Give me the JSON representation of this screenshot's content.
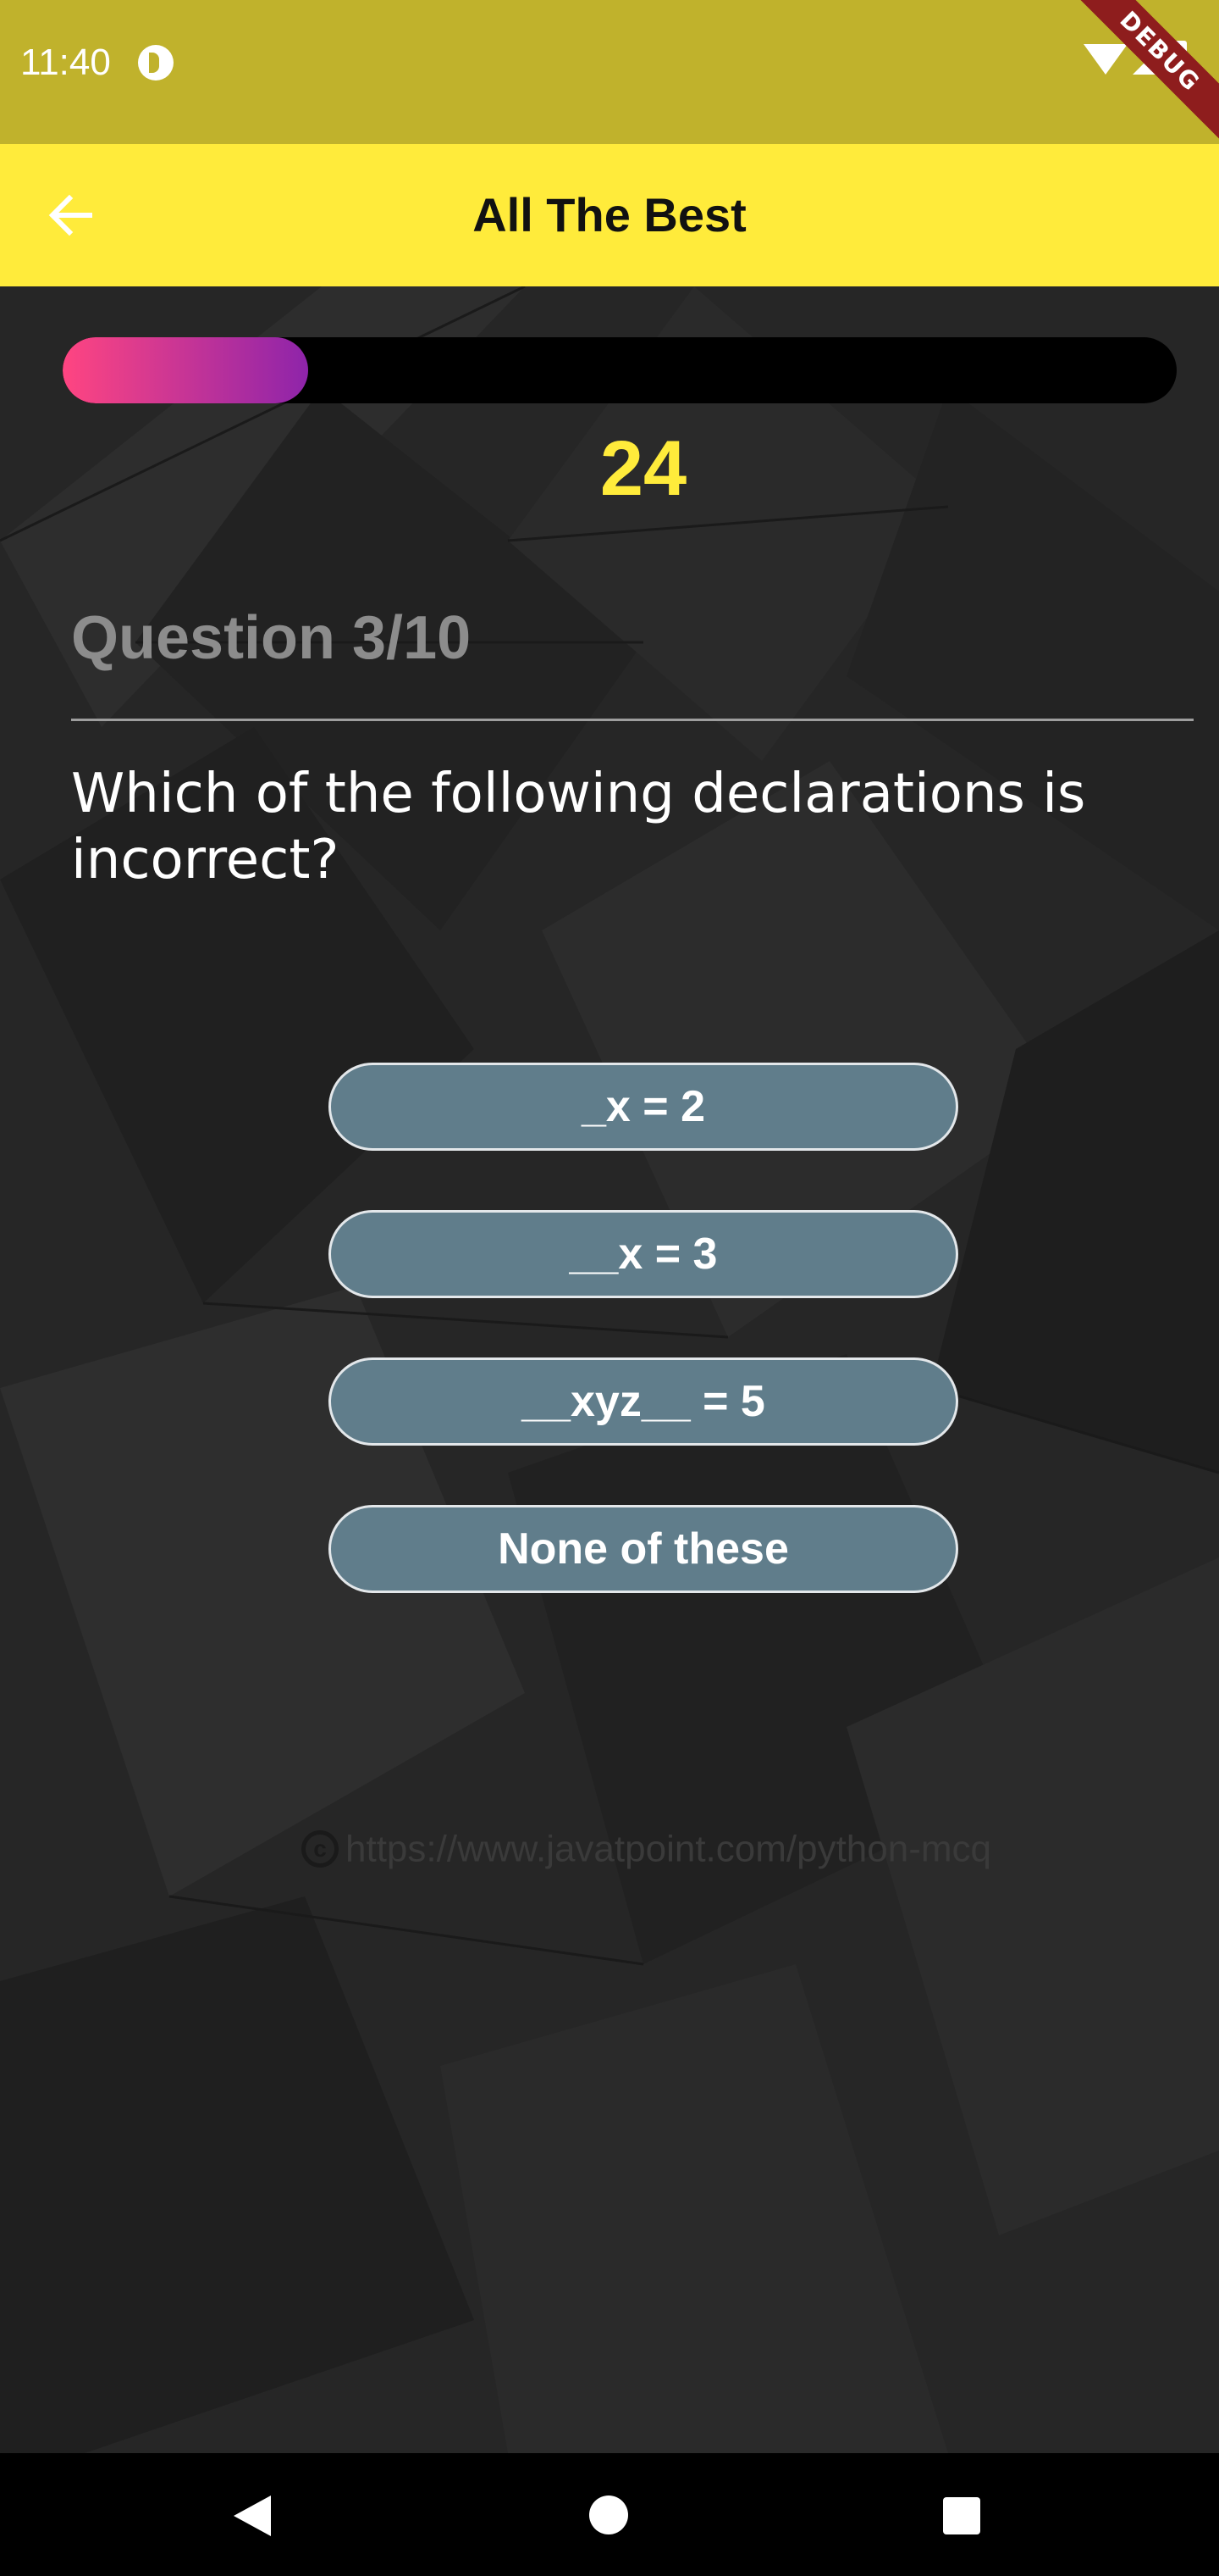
{
  "status_bar": {
    "time": "11:40",
    "app_icon": "pocket-casts-icon",
    "icons": [
      "wifi-icon",
      "cell-signal-icon",
      "battery-icon"
    ],
    "debug_banner": "DEBUG"
  },
  "app_bar": {
    "back_icon": "arrow-back-icon",
    "title": "All The Best",
    "color": "#ffeb3b"
  },
  "quiz": {
    "progress": 0.22,
    "progress_colors": [
      "#ff4581",
      "#8e24aa"
    ],
    "timer": "24",
    "question_counter": "Question 3/10",
    "question": "Which of the following declarations is incorrect?",
    "options": [
      "_x = 2",
      "__x = 3",
      "__xyz__ = 5",
      "None of these"
    ],
    "source": "https://www.javatpoint.com/python-mcq",
    "source_icon": "copyright-icon"
  },
  "nav_bar": {
    "icons": [
      "back-triangle-icon",
      "home-circle-icon",
      "recents-square-icon"
    ]
  },
  "colors": {
    "status_bar": "#c0b22c",
    "option_bg": "#607d8b",
    "timer": "#ffeb3b",
    "background": "#262626"
  }
}
